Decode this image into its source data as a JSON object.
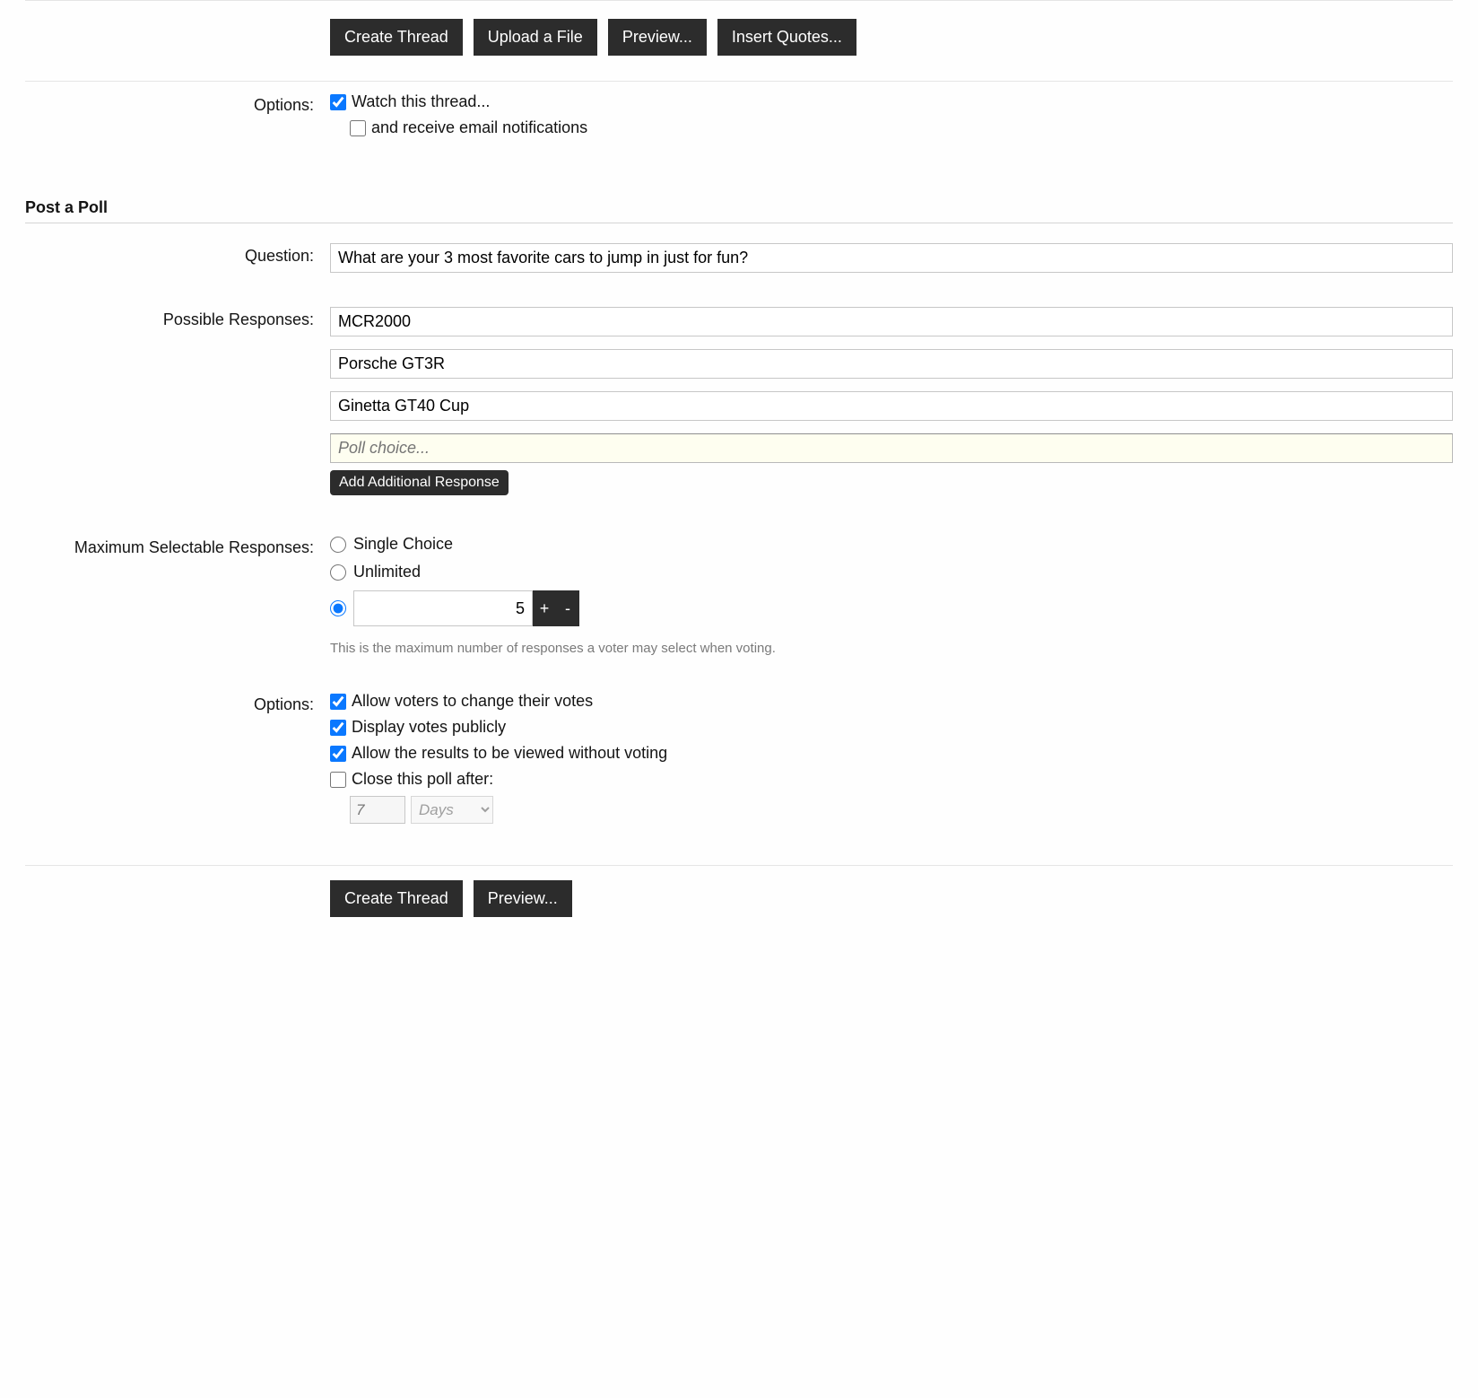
{
  "topButtons": {
    "createThread": "Create Thread",
    "uploadFile": "Upload a File",
    "preview": "Preview...",
    "insertQuotes": "Insert Quotes..."
  },
  "threadOptions": {
    "label": "Options:",
    "watch": "Watch this thread...",
    "email": "and receive email notifications"
  },
  "pollHeading": "Post a Poll",
  "question": {
    "label": "Question:",
    "value": "What are your 3 most favorite cars to jump in just for fun?"
  },
  "responses": {
    "label": "Possible Responses:",
    "items": [
      "MCR2000",
      "Porsche GT3R",
      "Ginetta GT40 Cup"
    ],
    "placeholder": "Poll choice...",
    "addButton": "Add Additional Response"
  },
  "maxSelectable": {
    "label": "Maximum Selectable Responses:",
    "single": "Single Choice",
    "unlimited": "Unlimited",
    "numberValue": "5",
    "plus": "+",
    "minus": "-",
    "helper": "This is the maximum number of responses a voter may select when voting."
  },
  "pollOptions": {
    "label": "Options:",
    "changeVotes": "Allow voters to change their votes",
    "publicVotes": "Display votes publicly",
    "viewWithoutVoting": "Allow the results to be viewed without voting",
    "closeAfter": "Close this poll after:",
    "closeNumber": "7",
    "closeUnit": "Days"
  },
  "bottomButtons": {
    "createThread": "Create Thread",
    "preview": "Preview..."
  }
}
